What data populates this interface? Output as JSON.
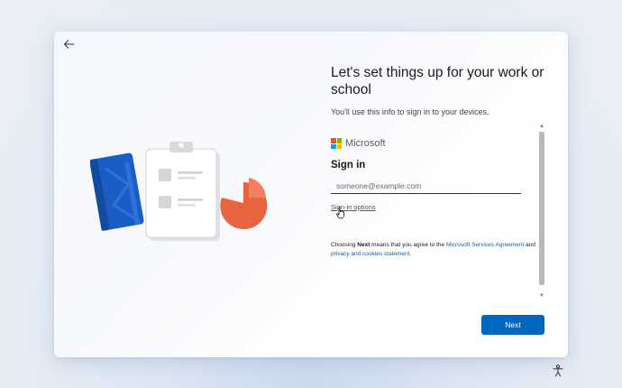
{
  "header": {
    "title": "Let's set things up for your work or school",
    "subtitle": "You'll use this info to sign in to your devices."
  },
  "signin": {
    "brand": "Microsoft",
    "heading": "Sign in",
    "email_placeholder": "someone@example.com",
    "email_value": "",
    "options_link": "Sign-in options"
  },
  "legal": {
    "prefix": "Choosing ",
    "next_word": "Next",
    "middle": " means that you agree to the ",
    "agreement_link": "Microsoft Services Agreement",
    "and": " and ",
    "privacy_link": "privacy and cookies statement",
    "suffix": "."
  },
  "footer": {
    "next_label": "Next"
  },
  "icons": {
    "back": "arrow-left",
    "accessibility": "accessibility-person",
    "scroll_up": "▲",
    "scroll_down": "▼"
  },
  "colors": {
    "accent": "#0067c0",
    "ms_red": "#f25022",
    "ms_green": "#7fba00",
    "ms_blue": "#00a4ef",
    "ms_yellow": "#ffb900",
    "link": "#1a5ca8"
  }
}
